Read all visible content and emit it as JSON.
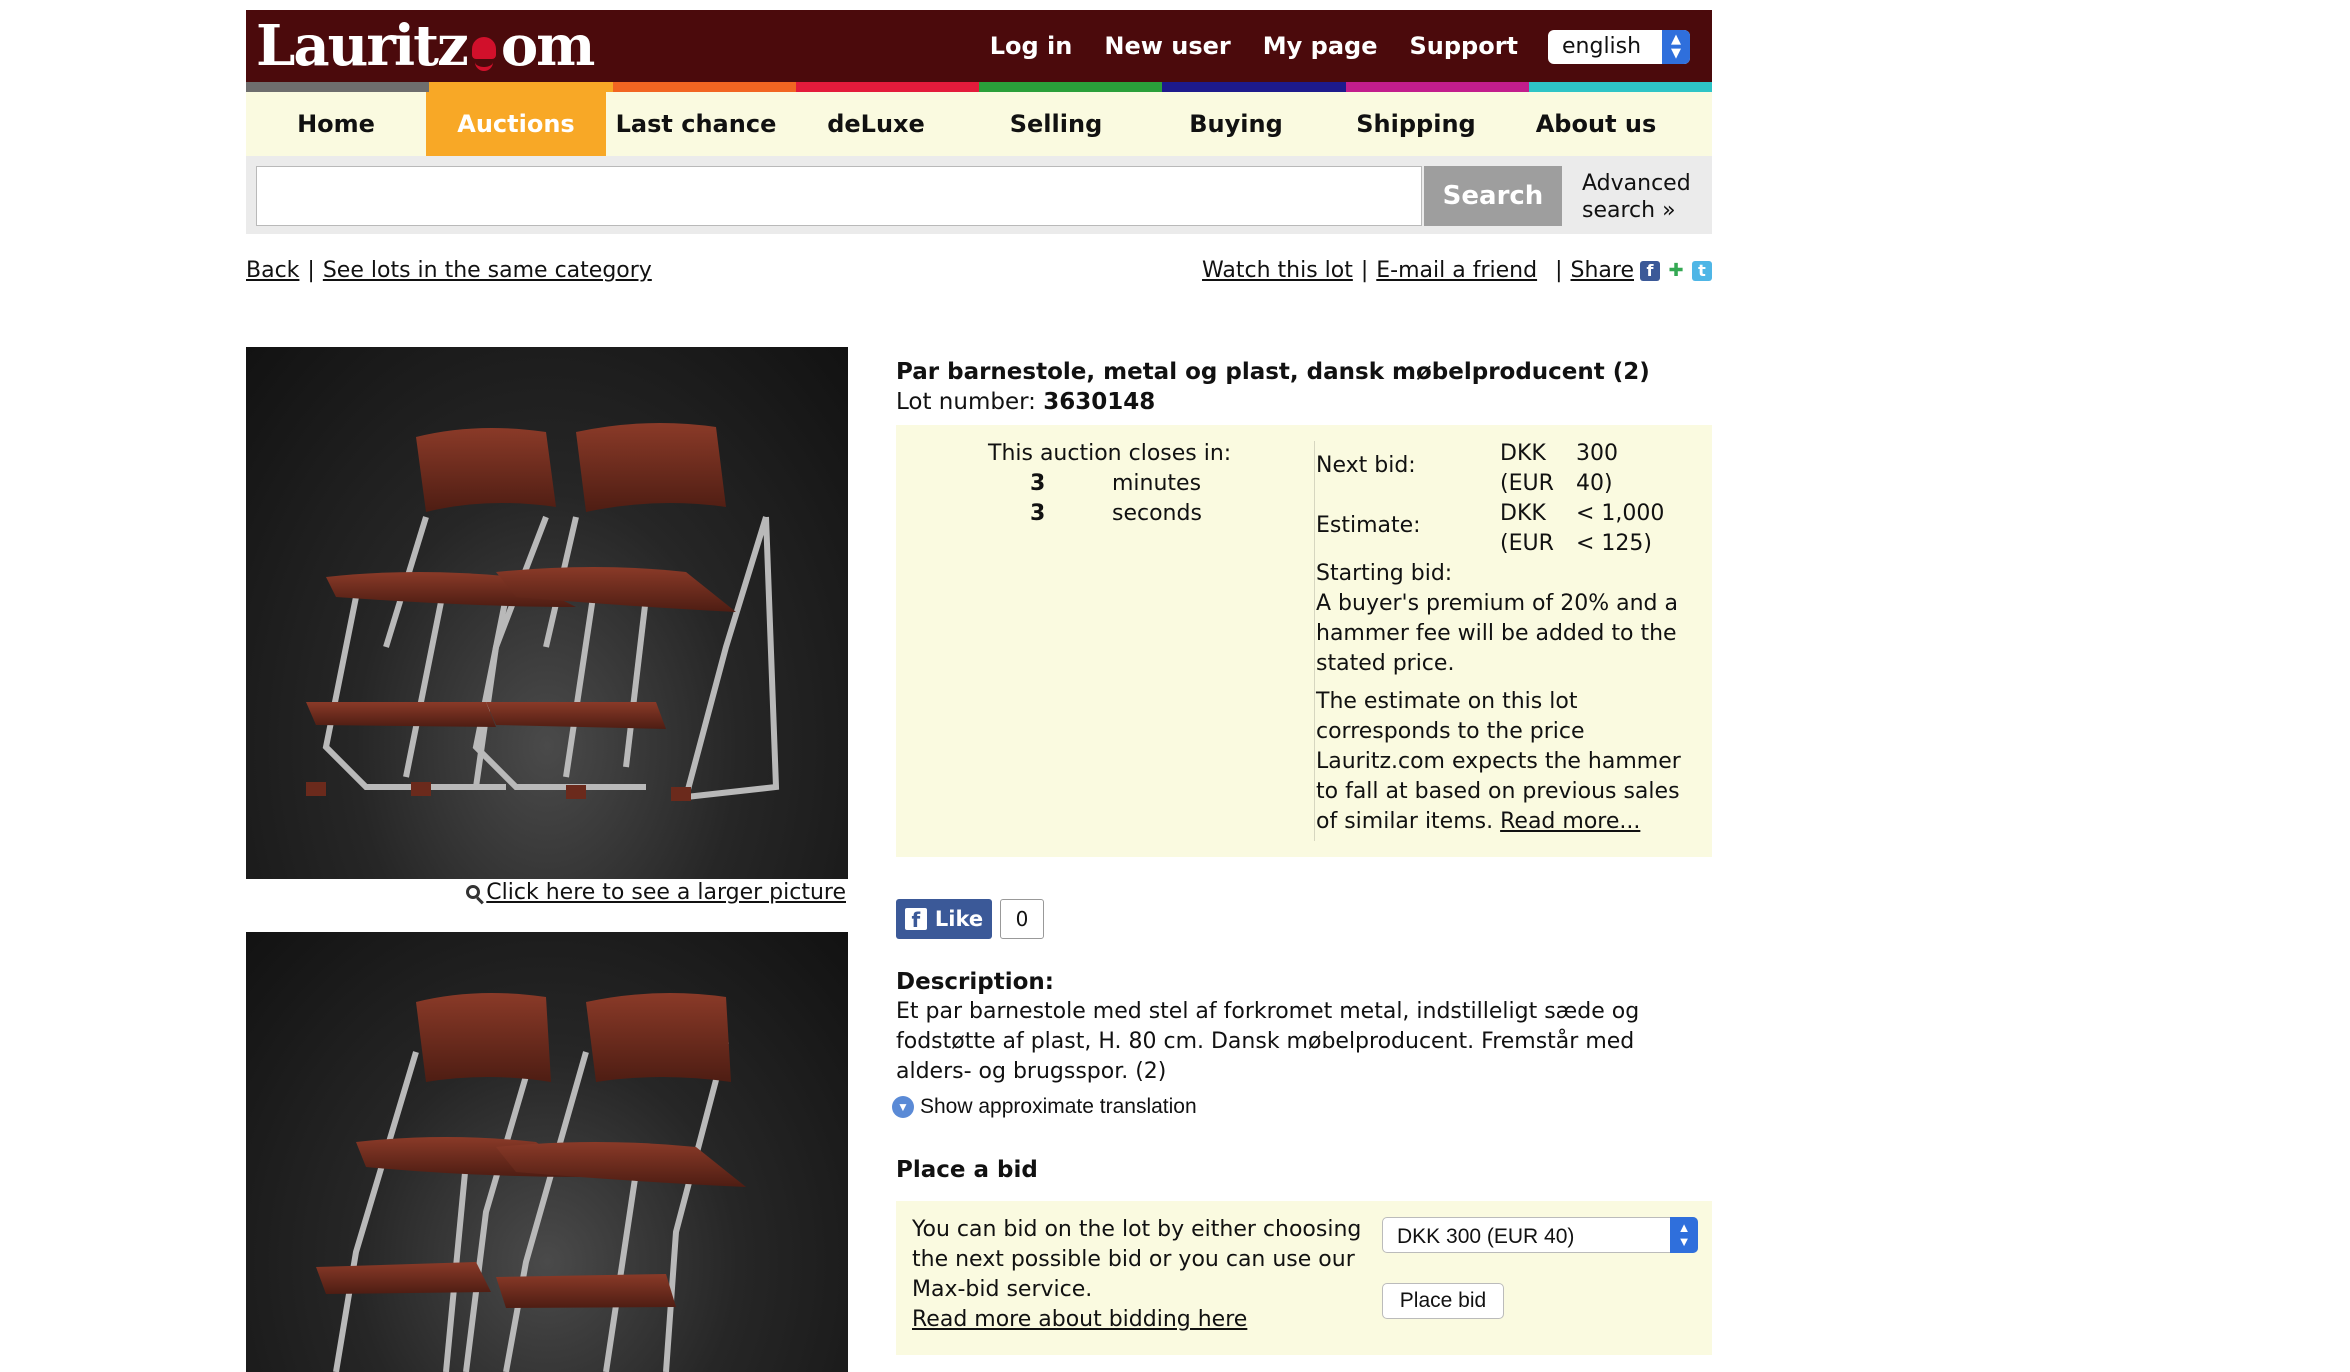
{
  "header": {
    "logo_text_left": "Lauritz",
    "logo_text_right": "om",
    "links": [
      "Log in",
      "New user",
      "My page",
      "Support"
    ],
    "language": "english",
    "stripe_colors": [
      "#6e6e6e",
      "#f8a826",
      "#f26522",
      "#e31b3b",
      "#2aa03a",
      "#1d1a8c",
      "#c21d8c",
      "#2ec4c6"
    ]
  },
  "nav": {
    "items": [
      "Home",
      "Auctions",
      "Last chance",
      "deLuxe",
      "Selling",
      "Buying",
      "Shipping",
      "About us"
    ],
    "active": "Auctions"
  },
  "search": {
    "placeholder": "",
    "button": "Search",
    "advanced_line1": "Advanced",
    "advanced_line2": "search »"
  },
  "crumbs": {
    "back": "Back",
    "same_category": "See lots in the same category",
    "watch": "Watch this lot",
    "email": "E-mail a friend",
    "share": "Share"
  },
  "images": {
    "enlarge_link": "Click here to see a larger picture"
  },
  "lot": {
    "title": "Par barnestole, metal og plast, dansk møbelproducent (2)",
    "number_label": "Lot number:",
    "number": "3630148"
  },
  "auction": {
    "closes_label": "This auction closes in:",
    "countdown": [
      {
        "value": "3",
        "unit": "minutes"
      },
      {
        "value": "3",
        "unit": "seconds"
      }
    ],
    "next_bid_label": "Next bid:",
    "next_bid_dkk_cur": "DKK",
    "next_bid_dkk": "300",
    "next_bid_eur_cur": "(EUR",
    "next_bid_eur": "40)",
    "estimate_label": "Estimate:",
    "estimate_dkk_cur": "DKK",
    "estimate_dkk": "< 1,000",
    "estimate_eur_cur": "(EUR",
    "estimate_eur": "< 125)",
    "starting_bid_label": "Starting bid:",
    "premium_note": "A buyer's premium of 20% and a hammer fee will be added to the stated price.",
    "estimate_note": "The estimate on this lot corresponds to the price Lauritz.com expects the hammer to fall at based on previous sales of similar items.",
    "read_more": "Read more..."
  },
  "facebook": {
    "like_label": "Like",
    "count": "0"
  },
  "description": {
    "heading": "Description:",
    "text": "Et par barnestole med stel af forkromet metal, indstilleligt sæde og fodstøtte af plast, H. 80 cm. Dansk møbelproducent. Fremstår med alders- og brugsspor. (2)",
    "translate": "Show approximate translation"
  },
  "place_bid": {
    "heading": "Place a bid",
    "text": "You can bid on the lot by either choosing the next possible bid or you can use our Max-bid service.",
    "read_more": "Read more about bidding here",
    "selected_bid": "DKK 300  (EUR 40)",
    "button": "Place bid"
  }
}
